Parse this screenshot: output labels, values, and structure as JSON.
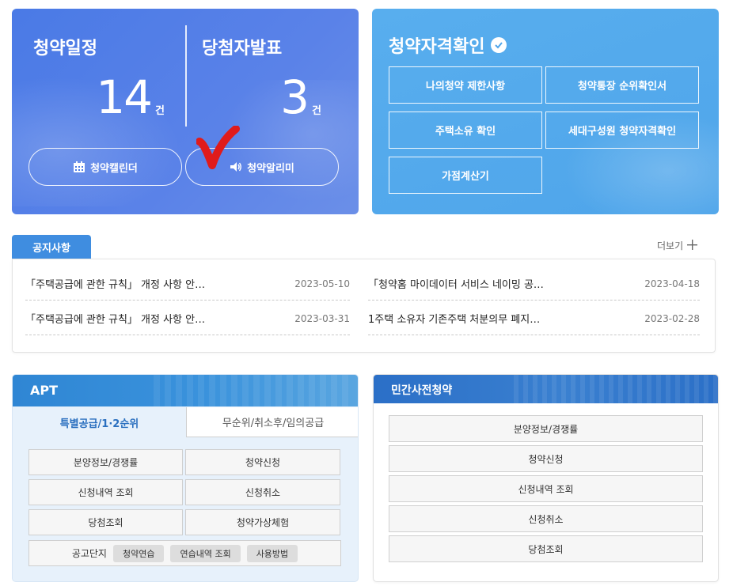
{
  "schedule": {
    "title_left": "청약일정",
    "title_right": "당첨자발표",
    "count_left": "14",
    "count_right": "3",
    "unit": "건",
    "calendar_button": "청약캘린더",
    "alarm_button": "청약알리미",
    "calendar_icon": "calendar-icon",
    "alarm_icon": "speaker-icon"
  },
  "qualification": {
    "title": "청약자격확인",
    "title_icon": "check-circle-icon",
    "buttons": [
      "나의청약 제한사항",
      "청약통장 순위확인서",
      "주택소유 확인",
      "세대구성원 청약자격확인",
      "가점계산기"
    ]
  },
  "notice": {
    "tab_label": "공지사항",
    "more_label": "더보기",
    "items": [
      {
        "title": "「주택공급에 관한 규칙」 개정 사항 안…",
        "date": "2023-05-10"
      },
      {
        "title": "「청약홈 마이데이터 서비스 네이밍 공…",
        "date": "2023-04-18"
      },
      {
        "title": "「주택공급에 관한 규칙」 개정 사항 안…",
        "date": "2023-03-31"
      },
      {
        "title": "1주택 소유자 기존주택 처분의무 폐지…",
        "date": "2023-02-28"
      }
    ]
  },
  "apt": {
    "title": "APT",
    "tab_active": "특별공급/1·2순위",
    "tab_inactive": "무순위/취소후/임의공급",
    "buttons": [
      "분양정보/경쟁률",
      "청약신청",
      "신청내역 조회",
      "신청취소",
      "당첨조회",
      "청약가상체험"
    ],
    "notice_label": "공고단지",
    "chips": [
      "청약연습",
      "연습내역 조회",
      "사용방법"
    ]
  },
  "private": {
    "title": "민간사전청약",
    "buttons": [
      "분양정보/경쟁률",
      "청약신청",
      "신청내역 조회",
      "신청취소",
      "당첨조회"
    ]
  },
  "colors": {
    "schedule_bg": "#4a7ae6",
    "qualification_bg": "#58aeee",
    "notice_tab": "#3f8de0",
    "apt_head": "#2f86d4",
    "private_head": "#2b6fc7",
    "annotation_check": "#e01b1b"
  }
}
